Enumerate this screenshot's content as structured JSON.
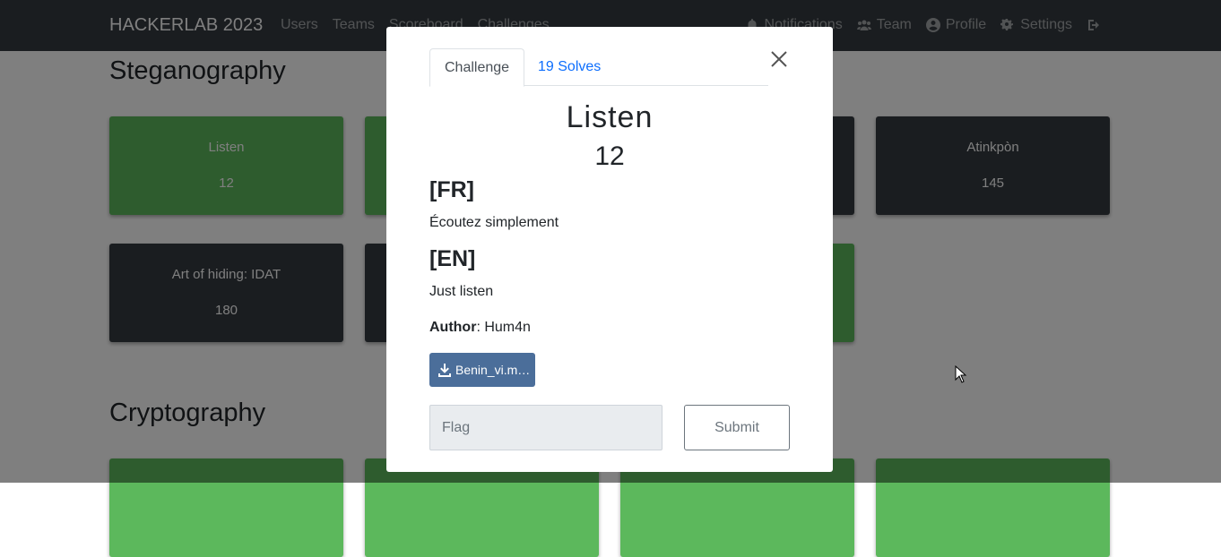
{
  "navbar": {
    "brand": "HACKERLAB 2023",
    "left_links": [
      "Users",
      "Teams",
      "Scoreboard",
      "Challenges"
    ],
    "right_links": {
      "notifications": "Notifications",
      "team": "Team",
      "profile": "Profile",
      "settings": "Settings"
    }
  },
  "sections": [
    {
      "title": "Steganography",
      "challenges": [
        {
          "name": "Listen",
          "value": "12",
          "solved": true
        },
        {
          "name": "",
          "value": "",
          "solved": true
        },
        {
          "name": "",
          "value": "",
          "solved": false
        },
        {
          "name": "Atinkpòn",
          "value": "145",
          "solved": false
        },
        {
          "name": "Art of hiding: IDAT",
          "value": "180",
          "solved": false
        },
        {
          "name": "",
          "value": "",
          "solved": false
        },
        {
          "name": "",
          "value": "",
          "solved": true
        }
      ]
    },
    {
      "title": "Cryptography",
      "challenges": []
    }
  ],
  "modal": {
    "tabs": {
      "challenge": "Challenge",
      "solves": "19 Solves"
    },
    "challenge_name": "Listen",
    "challenge_value": "12",
    "fr_heading": "[FR]",
    "fr_text": "Écoutez simplement",
    "en_heading": "[EN]",
    "en_text": "Just listen",
    "author_label": "Author",
    "author_value": ": Hum4n",
    "file_label": "Benin_vi.m…",
    "flag_placeholder": "Flag",
    "submit_label": "Submit"
  },
  "colors": {
    "navbar": "#343a40",
    "solved": "#5cb85c",
    "unsolved": "#343a40",
    "link": "#0d6efd",
    "file_button": "#4b6e9a"
  }
}
